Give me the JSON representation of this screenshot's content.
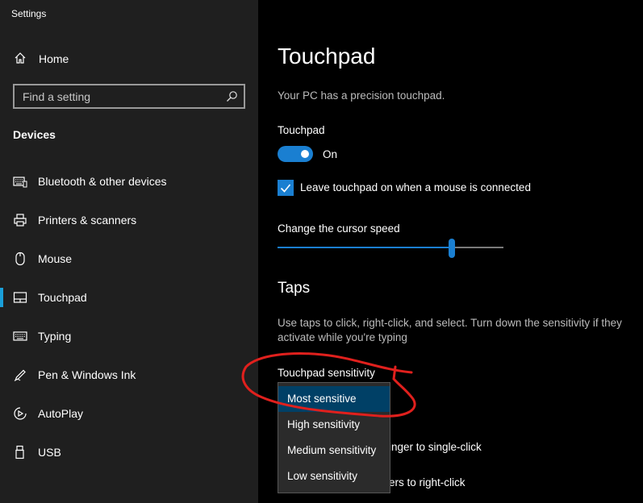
{
  "window": {
    "title": "Settings"
  },
  "sidebar": {
    "home_label": "Home",
    "search": {
      "placeholder": "Find a setting"
    },
    "section_title": "Devices",
    "items": [
      {
        "label": "Bluetooth & other devices",
        "icon": "keyboard-icon"
      },
      {
        "label": "Printers & scanners",
        "icon": "printer-icon"
      },
      {
        "label": "Mouse",
        "icon": "mouse-icon"
      },
      {
        "label": "Touchpad",
        "icon": "touchpad-icon",
        "selected": true
      },
      {
        "label": "Typing",
        "icon": "keyboard-icon"
      },
      {
        "label": "Pen & Windows Ink",
        "icon": "pen-icon"
      },
      {
        "label": "AutoPlay",
        "icon": "autoplay-icon"
      },
      {
        "label": "USB",
        "icon": "usb-icon"
      }
    ]
  },
  "main": {
    "title": "Touchpad",
    "description": "Your PC has a precision touchpad.",
    "touchpad": {
      "label": "Touchpad",
      "state": "On",
      "enabled": true
    },
    "leave_on_checkbox": {
      "label": "Leave touchpad on when a mouse is connected",
      "checked": true
    },
    "cursor_speed": {
      "label": "Change the cursor speed",
      "value_fraction": 0.77
    },
    "taps": {
      "heading": "Taps",
      "description": "Use taps to click, right-click, and select. Turn down the sensitivity if they activate while you're typing",
      "sensitivity_label": "Touchpad sensitivity",
      "options": [
        "Most sensitive",
        "High sensitivity",
        "Medium sensitivity",
        "Low sensitivity"
      ],
      "selected_index": 0,
      "obscured_option_1": "inger to single-click",
      "obscured_option_2": "ers to right-click"
    }
  },
  "colors": {
    "accent": "#1a7fd1",
    "selection": "#004066",
    "annotation": "#e0201d"
  }
}
